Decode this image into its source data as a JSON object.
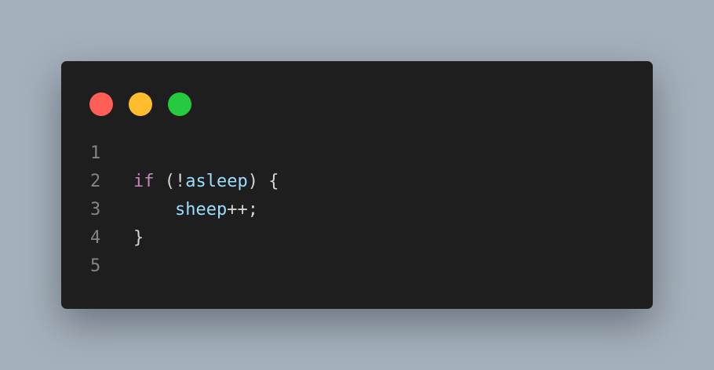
{
  "window": {
    "controls": [
      {
        "name": "close-button",
        "color": "#ff5f56"
      },
      {
        "name": "minimize-button",
        "color": "#ffbd2e"
      },
      {
        "name": "maximize-button",
        "color": "#27c93f"
      }
    ]
  },
  "code": {
    "lines": [
      {
        "number": "1",
        "tokens": []
      },
      {
        "number": "2",
        "tokens": [
          {
            "text": "if",
            "kind": "kw"
          },
          {
            "text": " (!",
            "kind": "pn"
          },
          {
            "text": "asleep",
            "kind": "id"
          },
          {
            "text": ") {",
            "kind": "pn"
          }
        ]
      },
      {
        "number": "3",
        "tokens": [
          {
            "text": "    ",
            "kind": "pn"
          },
          {
            "text": "sheep",
            "kind": "id"
          },
          {
            "text": "++;",
            "kind": "pn"
          }
        ]
      },
      {
        "number": "4",
        "tokens": [
          {
            "text": "}",
            "kind": "pn"
          }
        ]
      },
      {
        "number": "5",
        "tokens": []
      }
    ]
  },
  "colors": {
    "background": "#a4b0bc",
    "editor": "#1e1e1e",
    "keyword": "#c586c0",
    "identifier": "#9cdcfe",
    "punctuation": "#d4d4d4",
    "line_number": "#858585"
  }
}
